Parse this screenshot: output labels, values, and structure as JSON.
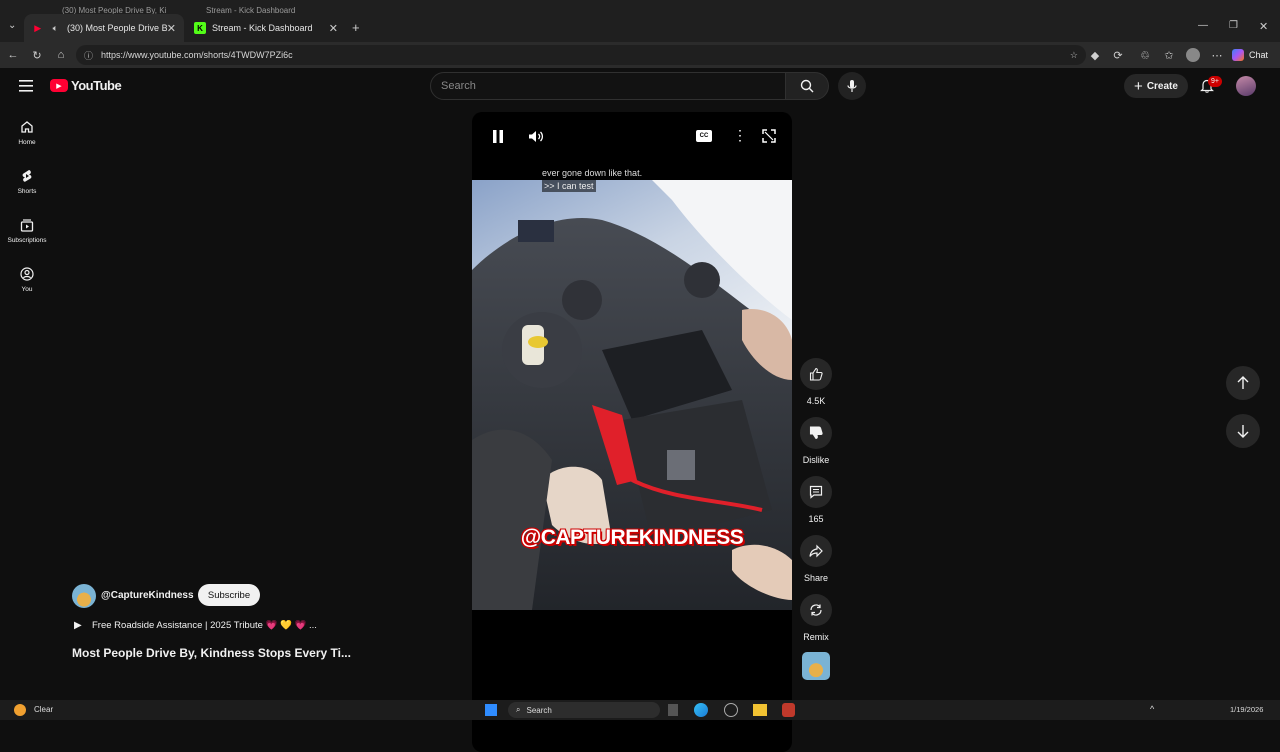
{
  "browser": {
    "tabs": [
      {
        "title": "(30) Most People Drive By, Ki",
        "active": true
      },
      {
        "title": "Stream - Kick Dashboard",
        "active": false
      }
    ],
    "ghost_tabs": [
      "(30) Most People Drive By, Ki",
      "Stream - Kick Dashboard"
    ],
    "url": "https://www.youtube.com/shorts/4TWDW7PZi6c",
    "chat_label": "Chat"
  },
  "youtube": {
    "logo_text": "YouTube",
    "search_placeholder": "Search",
    "create_label": "Create",
    "notification_badge": "9+",
    "sidebar": [
      {
        "label": "Home",
        "icon": "home-icon"
      },
      {
        "label": "Shorts",
        "icon": "shorts-icon"
      },
      {
        "label": "Subscriptions",
        "icon": "subscriptions-icon"
      },
      {
        "label": "You",
        "icon": "you-icon"
      }
    ],
    "short": {
      "captions": [
        "ever gone down like that.",
        ">> I can test"
      ],
      "overlay_text": "@CAPTUREKINDNESS",
      "channel": "@CaptureKindness",
      "subscribe_label": "Subscribe",
      "music": "Free Roadside Assistance | 2025 Tribute 💗 💛 💗 ...",
      "title": "Most People Drive By, Kindness Stops Every Ti...",
      "progress": 0.47
    },
    "actions": {
      "like": "4.5K",
      "dislike": "Dislike",
      "comments": "165",
      "share": "Share",
      "remix": "Remix"
    }
  },
  "taskbar": {
    "weather": "Clear",
    "search": "Search",
    "date": "1/19/2026"
  },
  "colors": {
    "accent": "#ff0033",
    "bg": "#0f0f0f"
  }
}
